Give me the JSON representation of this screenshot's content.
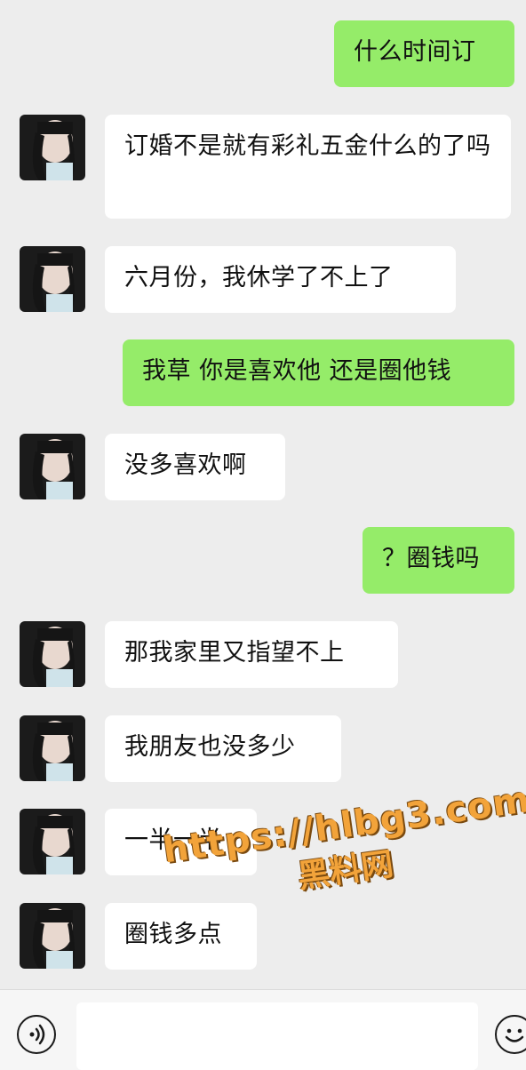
{
  "messages": [
    {
      "sender": "me",
      "text": "什么时间订"
    },
    {
      "sender": "other",
      "text": "订婚不是就有彩礼五金什么的了吗"
    },
    {
      "sender": "other",
      "text": "六月份，我休学了不上了"
    },
    {
      "sender": "me",
      "text": "我草 你是喜欢他 还是圈他钱"
    },
    {
      "sender": "other",
      "text": "没多喜欢啊"
    },
    {
      "sender": "me",
      "text": "？圈钱吗"
    },
    {
      "sender": "other",
      "text": "那我家里又指望不上"
    },
    {
      "sender": "other",
      "text": "我朋友也没多少"
    },
    {
      "sender": "other",
      "text": "一半一半"
    },
    {
      "sender": "other",
      "text": "圈钱多点"
    }
  ],
  "watermark": {
    "url": "https://hlbg3.com",
    "name": "黑料网"
  },
  "input_bar": {
    "voice_icon": "voice-icon",
    "emoji_icon": "emoji-icon"
  },
  "colors": {
    "background": "#ededed",
    "my_bubble": "#95ec69",
    "other_bubble": "#ffffff",
    "watermark": "#f2a33a"
  }
}
